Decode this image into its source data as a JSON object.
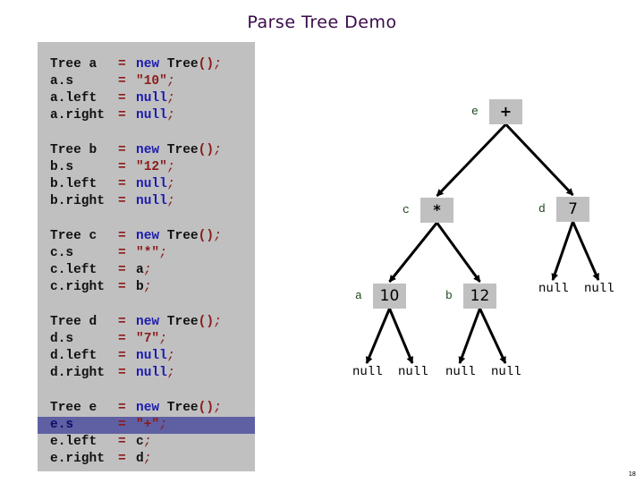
{
  "title": "Parse Tree Demo",
  "code": {
    "highlighted_line": "e.s",
    "blocks": [
      {
        "lines": [
          {
            "lhs": "Tree a ",
            "rhs": [
              {
                "t": "new",
                "c": "kw"
              },
              {
                "t": " Tree",
                "c": "ty"
              },
              {
                "t": "()",
                "c": "pn"
              },
              {
                "t": ";",
                "c": "semi"
              }
            ]
          },
          {
            "lhs": "a.s",
            "rhs": [
              {
                "t": "\"10\"",
                "c": "st"
              },
              {
                "t": ";",
                "c": "semi"
              }
            ]
          },
          {
            "lhs": "a.left",
            "rhs": [
              {
                "t": "null",
                "c": "kw"
              },
              {
                "t": ";",
                "c": "semi"
              }
            ]
          },
          {
            "lhs": "a.right",
            "rhs": [
              {
                "t": "null",
                "c": "kw"
              },
              {
                "t": ";",
                "c": "semi"
              }
            ]
          }
        ]
      },
      {
        "lines": [
          {
            "lhs": "Tree b ",
            "rhs": [
              {
                "t": "new",
                "c": "kw"
              },
              {
                "t": " Tree",
                "c": "ty"
              },
              {
                "t": "()",
                "c": "pn"
              },
              {
                "t": ";",
                "c": "semi"
              }
            ]
          },
          {
            "lhs": "b.s",
            "rhs": [
              {
                "t": "\"12\"",
                "c": "st"
              },
              {
                "t": ";",
                "c": "semi"
              }
            ]
          },
          {
            "lhs": "b.left",
            "rhs": [
              {
                "t": "null",
                "c": "kw"
              },
              {
                "t": ";",
                "c": "semi"
              }
            ]
          },
          {
            "lhs": "b.right",
            "rhs": [
              {
                "t": "null",
                "c": "kw"
              },
              {
                "t": ";",
                "c": "semi"
              }
            ]
          }
        ]
      },
      {
        "lines": [
          {
            "lhs": "Tree c ",
            "rhs": [
              {
                "t": "new",
                "c": "kw"
              },
              {
                "t": " Tree",
                "c": "ty"
              },
              {
                "t": "()",
                "c": "pn"
              },
              {
                "t": ";",
                "c": "semi"
              }
            ]
          },
          {
            "lhs": "c.s",
            "rhs": [
              {
                "t": "\"*\"",
                "c": "st"
              },
              {
                "t": ";",
                "c": "semi"
              }
            ]
          },
          {
            "lhs": "c.left",
            "rhs": [
              {
                "t": "a",
                "c": "id"
              },
              {
                "t": ";",
                "c": "semi"
              }
            ]
          },
          {
            "lhs": "c.right",
            "rhs": [
              {
                "t": "b",
                "c": "id"
              },
              {
                "t": ";",
                "c": "semi"
              }
            ]
          }
        ]
      },
      {
        "lines": [
          {
            "lhs": "Tree d ",
            "rhs": [
              {
                "t": "new",
                "c": "kw"
              },
              {
                "t": " Tree",
                "c": "ty"
              },
              {
                "t": "()",
                "c": "pn"
              },
              {
                "t": ";",
                "c": "semi"
              }
            ]
          },
          {
            "lhs": "d.s",
            "rhs": [
              {
                "t": "\"7\"",
                "c": "st"
              },
              {
                "t": ";",
                "c": "semi"
              }
            ]
          },
          {
            "lhs": "d.left",
            "rhs": [
              {
                "t": "null",
                "c": "kw"
              },
              {
                "t": ";",
                "c": "semi"
              }
            ]
          },
          {
            "lhs": "d.right",
            "rhs": [
              {
                "t": "null",
                "c": "kw"
              },
              {
                "t": ";",
                "c": "semi"
              }
            ]
          }
        ]
      },
      {
        "lines": [
          {
            "lhs": "Tree e ",
            "rhs": [
              {
                "t": "new",
                "c": "kw"
              },
              {
                "t": " Tree",
                "c": "ty"
              },
              {
                "t": "()",
                "c": "pn"
              },
              {
                "t": ";",
                "c": "semi"
              }
            ]
          },
          {
            "lhs": "e.s",
            "rhs": [
              {
                "t": "\"+\"",
                "c": "st"
              },
              {
                "t": ";",
                "c": "semi"
              }
            ]
          },
          {
            "lhs": "e.left",
            "rhs": [
              {
                "t": "c",
                "c": "id"
              },
              {
                "t": ";",
                "c": "semi"
              }
            ]
          },
          {
            "lhs": "e.right",
            "rhs": [
              {
                "t": "d",
                "c": "id"
              },
              {
                "t": ";",
                "c": "semi"
              }
            ]
          }
        ]
      }
    ],
    "equals": "="
  },
  "tree": {
    "nodes": [
      {
        "id": "e",
        "label": "e",
        "value": "+"
      },
      {
        "id": "c",
        "label": "c",
        "value": "*"
      },
      {
        "id": "d",
        "label": "d",
        "value": "7"
      },
      {
        "id": "a",
        "label": "a",
        "value": "10"
      },
      {
        "id": "b",
        "label": "b",
        "value": "12"
      }
    ],
    "edges": [
      {
        "from": "e",
        "to": "c"
      },
      {
        "from": "e",
        "to": "d"
      },
      {
        "from": "c",
        "to": "a"
      },
      {
        "from": "c",
        "to": "b"
      },
      {
        "from": "a",
        "to": "null-a-left"
      },
      {
        "from": "a",
        "to": "null-a-right"
      },
      {
        "from": "b",
        "to": "null-b-left"
      },
      {
        "from": "b",
        "to": "null-b-right"
      },
      {
        "from": "d",
        "to": "null-d-left"
      },
      {
        "from": "d",
        "to": "null-d-right"
      }
    ],
    "null_text": "null"
  },
  "colors": {
    "title": "#3a0a4a",
    "panel": "#c0c0c0",
    "highlight": "#5f5fa3",
    "keyword": "#1a1ab0",
    "string": "#8b1a1a",
    "node_label": "#1e4a1e"
  },
  "page_number": "18"
}
